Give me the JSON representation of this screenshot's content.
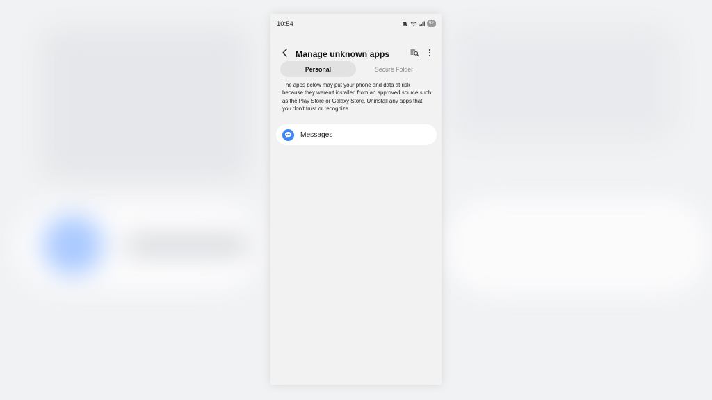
{
  "status_bar": {
    "time": "10:54",
    "battery": "52",
    "icons": [
      "mute-icon",
      "wifi-icon",
      "signal-icon",
      "battery-icon"
    ]
  },
  "app_bar": {
    "title": "Manage unknown apps",
    "back_icon": "back-arrow-icon",
    "search_icon": "search-list-icon",
    "more_icon": "more-vertical-icon"
  },
  "tabs": [
    {
      "label": "Personal",
      "active": true
    },
    {
      "label": "Secure Folder",
      "active": false
    }
  ],
  "description": "The apps below may put your phone and data at risk because they weren't installed from an approved source such as the Play Store or Galaxy Store. Uninstall any apps that you don't trust or recognize.",
  "apps": [
    {
      "label": "Messages",
      "icon": "messages-icon"
    }
  ],
  "colors": {
    "accent": "#3e86f5",
    "screen_bg": "#f2f2f3",
    "active_tab_bg": "#e2e2e3"
  }
}
